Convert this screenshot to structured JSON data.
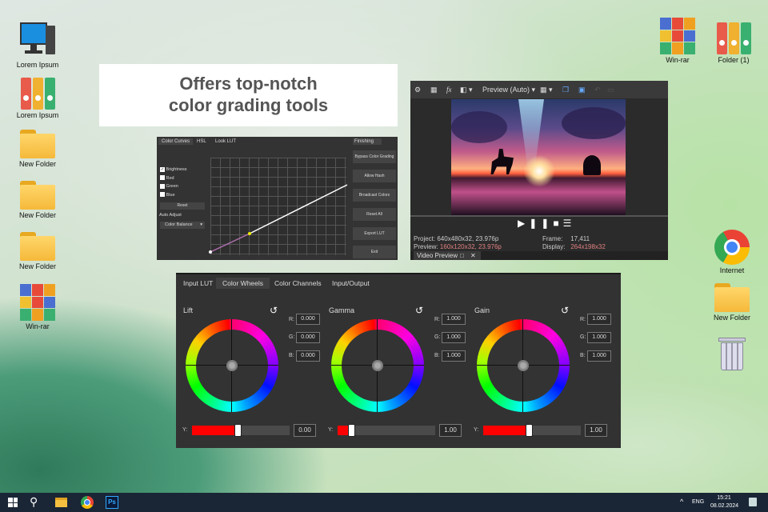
{
  "desktop_left": [
    {
      "label": "Lorem Ipsum",
      "icon": "computer-icon"
    },
    {
      "label": "Lorem Ipsum",
      "icon": "binders-icon"
    },
    {
      "label": "New Folder",
      "icon": "folder-icon"
    },
    {
      "label": "New Folder",
      "icon": "folder-icon"
    },
    {
      "label": "New Folder",
      "icon": "folder-icon"
    },
    {
      "label": "Win-rar",
      "icon": "winrar-icon"
    }
  ],
  "desktop_right": [
    {
      "label": "Win-rar",
      "icon": "winrar-icon"
    },
    {
      "label": "Folder (1)",
      "icon": "binders-icon"
    },
    {
      "label": "Internet",
      "icon": "chrome-icon"
    },
    {
      "label": "New Folder",
      "icon": "folder-icon"
    },
    {
      "label": "",
      "icon": "recycle-bin-icon"
    }
  ],
  "headline": {
    "line1": "Offers top-notch",
    "line2": "color grading tools"
  },
  "curves": {
    "tabs": [
      "Color Curves",
      "HSL",
      "Look LUT"
    ],
    "finishing_tab": "Finishing",
    "channels": [
      {
        "label": "Brightness",
        "checked": true
      },
      {
        "label": "Red",
        "checked": false
      },
      {
        "label": "Green",
        "checked": false
      },
      {
        "label": "Blue",
        "checked": false
      }
    ],
    "reset": "Reset",
    "auto_adjust": "Auto Adjust",
    "auto_select": "Color Balance",
    "buttons": [
      "Bypass Color Grading",
      "Allow Hash",
      "Broadcast Colors",
      "Reset All",
      "Export LUT",
      "Exit"
    ]
  },
  "preview": {
    "mode": "Preview (Auto)",
    "project_label": "Project:",
    "project": "640x480x32, 23.976p",
    "preview_label": "Preview:",
    "preview": "160x120x32, 23.976p",
    "frame_label": "Frame:",
    "frame": "17,411",
    "display_label": "Display:",
    "display": "264x198x32",
    "tab": "Video Preview"
  },
  "wheels_panel": {
    "tabs": [
      "Input LUT",
      "Color Wheels",
      "Color Channels",
      "Input/Output"
    ],
    "active_tab": 1,
    "wheels": [
      {
        "name": "Lift",
        "r": "0.000",
        "g": "0.000",
        "b": "0.000",
        "y": "0.00",
        "y_fill": 0.47
      },
      {
        "name": "Gamma",
        "r": "1.000",
        "g": "1.000",
        "b": "1.000",
        "y": "1.00",
        "y_fill": 0.14
      },
      {
        "name": "Gain",
        "r": "1.000",
        "g": "1.000",
        "b": "1.000",
        "y": "1.00",
        "y_fill": 0.47
      }
    ],
    "labels": {
      "r": "R:",
      "g": "G:",
      "b": "B:",
      "y": "Y:"
    }
  },
  "taskbar": {
    "lang": "ENG",
    "time": "15:21",
    "date": "08.02.2024"
  },
  "colors": {
    "accent_red": "#ff0000",
    "taskbar": "#1a2636",
    "pink_text": "#e08080"
  }
}
